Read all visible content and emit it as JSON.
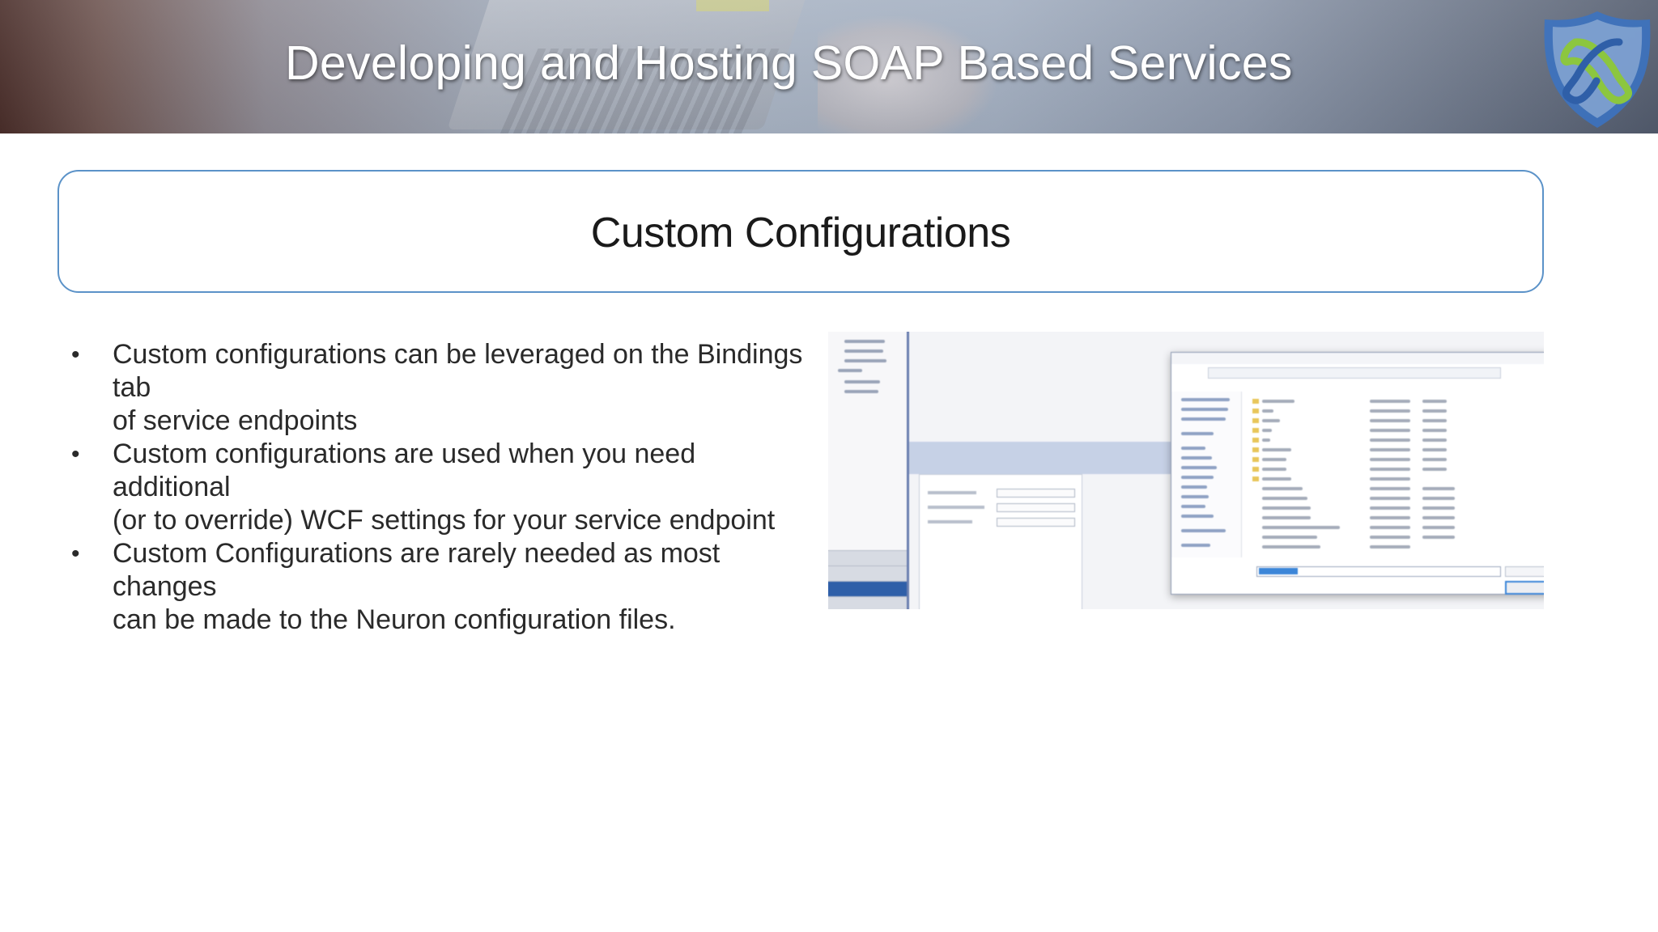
{
  "slide": {
    "header_title": "Developing and Hosting SOAP Based Services",
    "logo_icon": "shield-logo-icon",
    "subtitle": "Custom Configurations",
    "bullets": [
      {
        "lines": [
          "Custom configurations can be leveraged on the Bindings tab",
          "of service endpoints"
        ]
      },
      {
        "lines": [
          "Custom configurations are used when you need additional",
          "(or to override) WCF settings for your service endpoint"
        ]
      },
      {
        "lines": [
          "Custom Configurations are rarely needed as most changes",
          "can be made to the Neuron configuration files."
        ]
      }
    ]
  },
  "colors": {
    "subtitle_border": "#5b92c8",
    "logo_blue": "#2f5fa8",
    "logo_green": "#8cc63f"
  }
}
